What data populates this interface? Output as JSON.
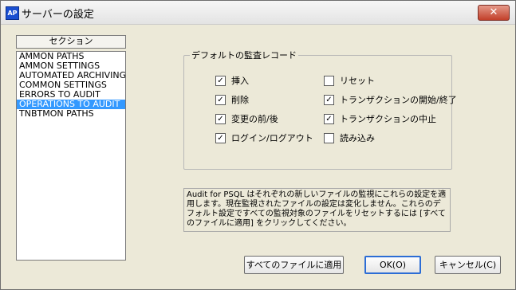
{
  "window": {
    "app_icon_text": "AP",
    "title": "サーバーの設定",
    "close_glyph": "✕"
  },
  "sections": {
    "header": "セクション",
    "items": [
      {
        "label": "AMMON PATHS",
        "selected": false
      },
      {
        "label": "AMMON SETTINGS",
        "selected": false
      },
      {
        "label": "AUTOMATED ARCHIVING",
        "selected": false
      },
      {
        "label": "COMMON SETTINGS",
        "selected": false
      },
      {
        "label": "ERRORS TO AUDIT",
        "selected": false
      },
      {
        "label": "OPERATIONS TO AUDIT",
        "selected": true
      },
      {
        "label": "TNBTMON PATHS",
        "selected": false
      }
    ]
  },
  "default_audit_records": {
    "title": "デフォルトの監査レコード",
    "left_checkboxes": [
      {
        "label": "挿入",
        "checked": true
      },
      {
        "label": "削除",
        "checked": true
      },
      {
        "label": "変更の前/後",
        "checked": true
      },
      {
        "label": "ログイン/ログアウト",
        "checked": true
      }
    ],
    "right_checkboxes": [
      {
        "label": "リセット",
        "checked": false
      },
      {
        "label": "トランザクションの開始/終了",
        "checked": true
      },
      {
        "label": "トランザクションの中止",
        "checked": true
      },
      {
        "label": "読み込み",
        "checked": false
      }
    ]
  },
  "info_text": "Audit for PSQL はそれぞれの新しいファイルの監視にこれらの設定を適用します。現在監視されたファイルの設定は変化しません。これらのデフォルト設定ですべての監視対象のファイルをリセットするには [すべてのファイルに適用] をクリックしてください。",
  "buttons": {
    "apply_all": "すべてのファイルに適用",
    "ok": "OK(O)",
    "cancel": "キャンセル(C)"
  }
}
